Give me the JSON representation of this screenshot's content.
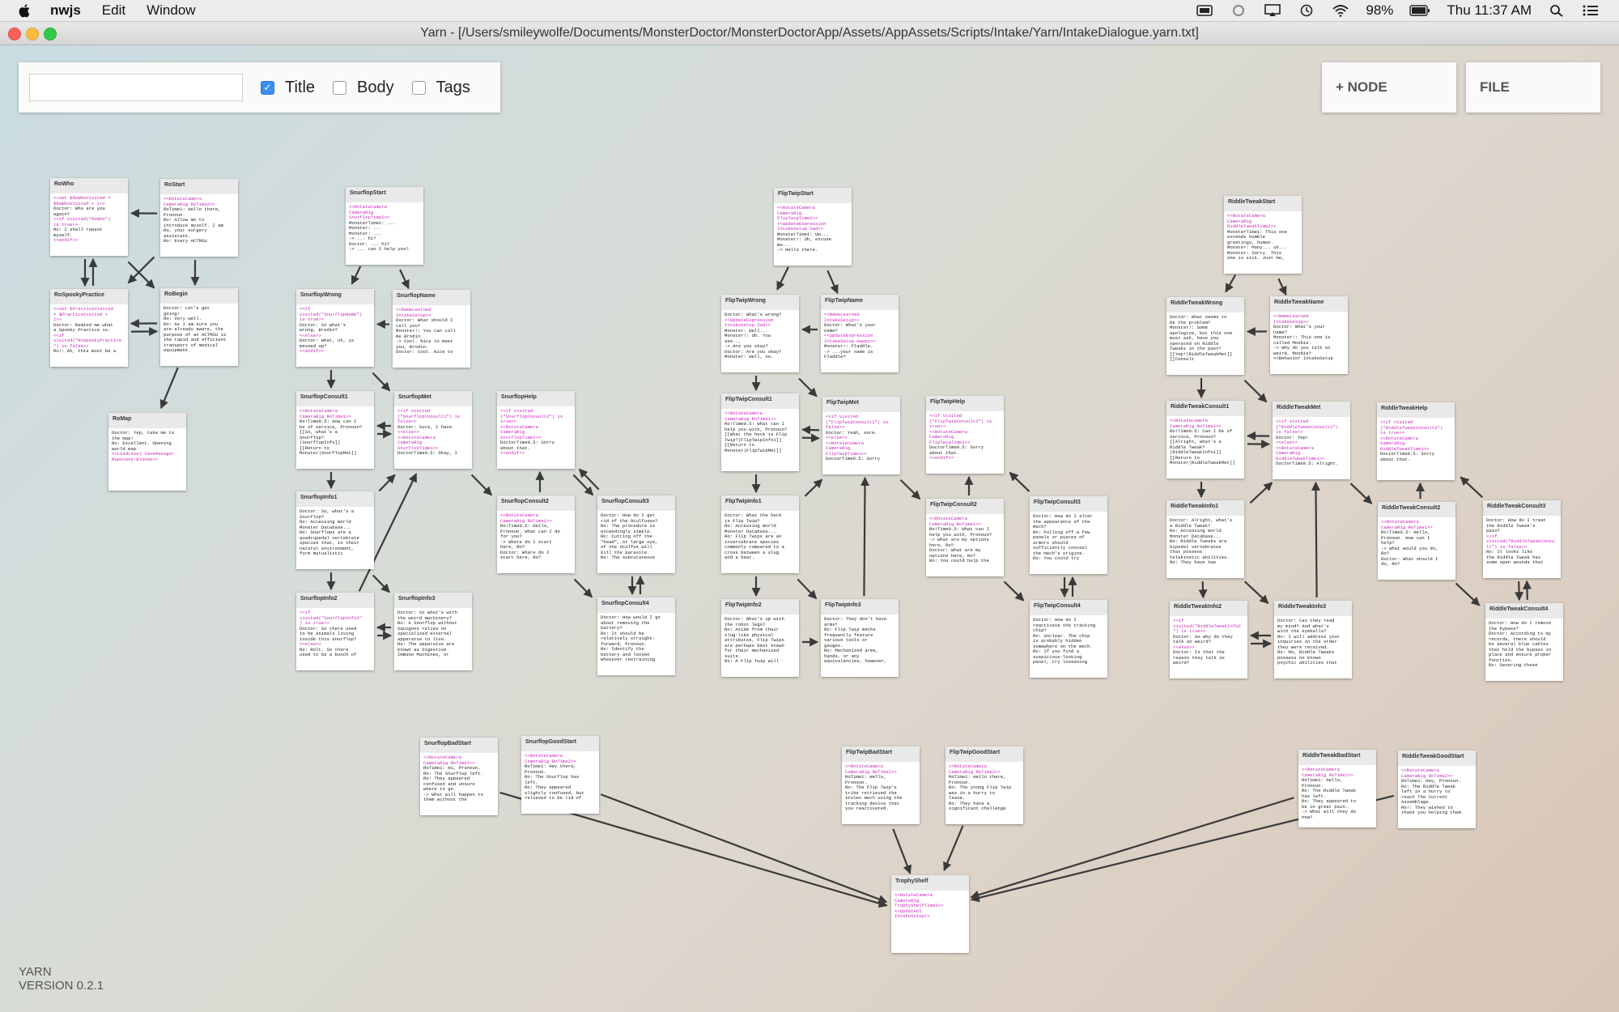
{
  "menubar": {
    "app": "nwjs",
    "items": [
      "Edit",
      "Window"
    ],
    "battery": "98%",
    "clock": "Thu 11:37 AM"
  },
  "window": {
    "title": "Yarn - [/Users/smileywolfe/Documents/MonsterDoctor/MonsterDoctorApp/Assets/AppAssets/Scripts/Intake/Yarn/IntakeDialogue.yarn.txt]"
  },
  "search": {
    "value": "",
    "title_label": "Title",
    "body_label": "Body",
    "tags_label": "Tags",
    "title_checked": true,
    "body_checked": false,
    "tags_checked": false
  },
  "buttons": {
    "node": "+ NODE",
    "file": "FILE"
  },
  "nodes": [
    {
      "title": "RoWho",
      "body": "<<set $RoWhoVisited =\n$RoWhoVisited + 1>>\nDoctor: Who are you\nagain?\n<<if visited(\"RoWho\")\nis true>>\nRo: I shall repeat\nmyself.\n<<endif>>"
    },
    {
      "title": "RoStart",
      "body": "<<RotateCamera\nCameraRig RoTime2>>\nRoTime1: Hello there,\nPronoun.\nRo: Allow me to\nintroduce myself. I am\nRo, your surgery\nassistant.\nRo: Every ACTMSU"
    },
    {
      "title": "RoSpookyPractice",
      "body": "<<set $PracticeVisited\n= $PracticeVisited +\n1>>\nDoctor: Remind me what\na Spooky Practice is.\n<<if\nvisited(\"RoSpookyPractice\n\") is false>>\nRo!: Ah, this must be a"
    },
    {
      "title": "RoBegin",
      "body": "Doctor: Let's get\ngoing!\nRo: Very well.\nRo: As I am sure you\nare already aware, the\npurpose of an ACTMSU is\nthe rapid and efficient\ntransport of medical\nequipment."
    },
    {
      "title": "RoMap",
      "body": "Doctor: Yep, take me to\nthe map!\nRo: Excellent. Opening\nworld map.\n<<LoadLevel SaveManager\nMapScene:Blonds>>"
    },
    {
      "title": "SnurflopStart",
      "body": "<<RotateCamera\nCameraRig\nSnurflopTime2>>\nMonsterTime1: ...\nMonster: ...\nMonster: ...\n-> ... hi?\nDoctor: ... hi?\n-> ... can I help you?"
    },
    {
      "title": "SnurflopWrong",
      "body": "<<if\nvisited(\"SnurflopName\")\nis true>>\nDoctor: So what's\nwrong, Brodin?\n<<else>>\nDoctor: What, uh, is\nmessed up?\n<<endif>>"
    },
    {
      "title": "SnurflopName",
      "body": "<<NameLearned\nIntakeSetup>>\nDoctor: What should I\ncall you?\nMonster!: You can call\nme Brodin.\n-> Cool. Nice to meet\nyou, Brodin.\nDoctor: Cool. Nice to"
    },
    {
      "title": "SnurflopConsult1",
      "body": "<<RotateCamera\nCameraRig RoTime1>>\nRo!Time0.5: How can I\nbe of service, Pronoun?\n[[So, what's a\nSnurflop?\n|SnurflopInfo]]\n[[Return to\nMonster|SnurflopMet]]"
    },
    {
      "title": "SnurflopMet",
      "body": "<<if visited\n(\"SnurflopConsult1\") is\nfalse>>\nDoctor: Sure, I have.\n<<else>>\n<<RotateCamera\nCameraRig\nSnurflopTime1>>\nDoctorTime0.5: Okay, I"
    },
    {
      "title": "SnurflopHelp",
      "body": "<<if visited\n(\"SnurflopConsult2\") is\ntrue>>\n<<RotateCamera\nCameraRig\nSnurflopTime1>>\nDoctorTime0.5: Sorry\nabout that.\n<<endif>>"
    },
    {
      "title": "SnurflopInfo1",
      "body": "Doctor: So, what's a\nSnurflop?\nRo: Accessing World\nMonster Database...\nRo: Snurflops are a\nquadrupedal vertebrate\nspecies that, in their\nnatural environment,\nform mutualistic"
    },
    {
      "title": "SnurflopConsult2",
      "body": "<<RotateCamera\nCameraRig RoTime1>>\nRo!Time0.5: Hello,\nPronoun. What can I do\nfor you?\n-> Where do I start\nhere, Ro?\nDoctor: Where do I\nstart here, Ro?"
    },
    {
      "title": "SnurflopConsult3",
      "body": "Doctor: How do I get\nrid of the Oculfuses?\nRo: The procedure is\nexceedingly simple.\nRo: Cutting off the\n\"head\", or large eye,\nof the Oculfus will\nkill the parasite.\nRo: The subcutaneous"
    },
    {
      "title": "SnurflopInfo2",
      "body": "<<if\nvisited(\"SnurflopInfo2\"\n) is true>>\nDoctor: So there used\nto be animals living\ninside this Snurflop?\n<<else>>\nRo: Rolt. So there\nused to be a bunch of"
    },
    {
      "title": "SnurflopInfo3",
      "body": "Doctor: So what's with\nthe weird machinery?\nRo: A Snurflop without\nSquigons relies on\nspecialized external\napparatus to live.\nRo: The apparatus are\nknown as Digestive\nImmuno Machines, or"
    },
    {
      "title": "SnurflopConsult4",
      "body": "Doctor: How would I go\nabout removing the\nbattery?\nRo: It should be\nrelatively straight-\nforward, Pronoun.\nRo: Identify the\nbattery and loosen\nwhatever restraining"
    },
    {
      "title": "FlipTwipStart",
      "body": "<<RotateCamera\nCameraRig\nFlipTwipTime2>>\n<<UpdateExpression\nIntakeSetup Sad>>\nMonsterTime1: Um...\nMonster!: Uh, excuse\nme...\n-> Hello there."
    },
    {
      "title": "FlipTwipWrong",
      "body": "Doctor: What's wrong?\n<<UpdateExpression\nIntakeSetup Sad>>\nMonster: Well...\nMonster!: Uh. You\nsee...\n-> Are you okay?\nDoctor: Are you okay?\nMonster: Well, no."
    },
    {
      "title": "FlipTwipName",
      "body": "<<NameLearned\nIntakeSetup>>\nDoctor: What's your\nname?\n<<UpdateExpression\nIntakeSetup Happy>>\nMonster!: Fladdle.\n-> ...your name is\nFladdle?"
    },
    {
      "title": "FlipTwipConsult1",
      "body": "<<RotateCamera\nCameraRig RoTime1>>\nRo!Time0.5: What can I\nhelp you with, Pronoun?\n[[What the heck is Flip\nTwip?|FlipTwipInfo1]]\n[[Return to\nMonster|FlipTwipMet]]"
    },
    {
      "title": "FlipTwipMet",
      "body": "<<if visited\n(\"FlipTwipConsult1\") is\nfalse>>\nDoctor: Yeah, sure.\n<<else>>\n<<RotateCamera\nCameraRig\nFlipTwipTime1>>\nDoctorTime0.5: Sorry"
    },
    {
      "title": "FlipTwipHelp",
      "body": "<<if visited\n(\"FlipTwipConsult2\") is\ntrue>>\n<<RotateCamera\nCameraRig\nFlipTwipTime1>>\nDoctorTime0.5: Sorry\nabout that.\n<<endif>>"
    },
    {
      "title": "FlipTwipInfo1",
      "body": "Doctor: What the heck\nis Flip Twip?\nRo: Accessing World\nMonster Database...\nRo: Flip Twips are an\ninvertebrate species\ncommonly compared to a\ncross between a slug\nand a bear."
    },
    {
      "title": "FlipTwipConsult2",
      "body": "<<RotateCamera\nCameraRig RoTime1>>\nRo!Time0.5: What can I\nhelp you with, Pronoun?\n-> What are my options\nhere, Ro?\nDoctor: What are my\noptions here, Ro?\nRo: You could help the"
    },
    {
      "title": "FlipTwipConsult3",
      "body": "Doctor: How do I alter\nthe appearance of the\nmech?\nRo: Pulling off a few\npanels or pieces of\narmors should\nsufficiently conceal\nthe mech's origins.\nRo: You could try"
    },
    {
      "title": "FlipTwipInfo2",
      "body": "Doctor: What's up with\nthe robot legs?\nRo: Aside from their\nslug-like physical\nattributes, Flip Twips\nare perhaps best known\nfor their mechanized\nsuits.\nRo: A Flip Twip will"
    },
    {
      "title": "FlipTwipInfo3",
      "body": "Doctor: They don't have\narms?\nRo: Flip Twip mechs\nfrequently feature\nvarious tools or\ngauges.\nRo: Mechanized arms,\nhands, or any\nequivalencies, however,"
    },
    {
      "title": "FlipTwipConsult4",
      "body": "Doctor: How do I\nreactivate the tracking\nchip?\nRo: Unclear. The chip\nis probably hidden\nsomewhere on the mech.\nRo: If you find a\nsuspicious-looking\npanel, try loosening"
    },
    {
      "title": "RiddleTweakStart",
      "body": "<<RotateCamera\nCameraRig\nRiddleTweakTime2>>\nMonsterTime1: This one\nextends humble\ngreetings, human.\nMonster: Many... uh...\nMonster: Sorry. This\none is sick. Just me,"
    },
    {
      "title": "RiddleTweakWrong",
      "body": "Doctor: What seems to\nbe the problem?\nMonster!: Some\napologize, but this one\nmust ask, have you\noperated on Riddle\nTweaks in the past?\n[[Yep!|RiddleTweakMet]]\n[[Consult"
    },
    {
      "title": "RiddleTweakName",
      "body": "<<NameLearned\nIntakeSetup>>\nDoctor: What's your\nname?\nMonster!: This one is\ncalled Moobie.\n-> Why do you talk so\nweird, Moobie?\n<<Behavior IntakeSetup"
    },
    {
      "title": "RiddleTweakConsult1",
      "body": "<<RotateCamera\nCameraRig RoTime1>>\nRo!Time0.5: Can I be of\nservice, Pronoun?\n[[Alright, what's a\nRiddle Tweak?\n|RiddleTweakInfo1]]\n[[Return to\nMonster|RiddleTweakMet]]"
    },
    {
      "title": "RiddleTweakMet",
      "body": "<<if visited\n(\"RiddleTweakConsult1\")\nis false>>\nDoctor: Yep!\n<<else>>\n<<RotateCamera\nCameraRig\nRiddleTweakTime1>>\nDoctorTime0.5: Alright."
    },
    {
      "title": "RiddleTweakHelp",
      "body": "<<if visited\n(\"RiddleTweakConsult2\")\nis true>>\n<<RotateCamera\nCameraRig\nRiddleTweakTime1>>\nDoctorTime0.5: Sorry\nabout that."
    },
    {
      "title": "RiddleTweakInfo1",
      "body": "Doctor: Alright, what's\na Riddle Tweak?\nRo: Accessing World\nMonster Database...\nRo: Riddle Tweaks are\nbipedal vertebrates\nthat possess\ntelekinetic abilities.\nRo: They have two"
    },
    {
      "title": "RiddleTweakConsult2",
      "body": "<<RotateCamera\nCameraRig RoTime1>>\nRo!Time0.5: Hello,\nPronoun. How can I\nhelp?\n-> What would you do,\nRo?\nDoctor: What should I\ndo, Ro?"
    },
    {
      "title": "RiddleTweakConsult3",
      "body": "Doctor: How do I treat\nthe Riddle Tweak's\npain?\n<<if\nvisited(\"RiddleTweakConsu\nlt\") is false>>\nRo: It looks like\nthe Riddle Tweak has\nsome open wounds that"
    },
    {
      "title": "RiddleTweakInfo2",
      "body": "<<if\nvisited(\"RiddleTweakInfo2\n\") is true>>\nDoctor: So why do they\ntalk so weird?\n<<else>>\nDoctor: Is that the\nreason they talk so\nweird?"
    },
    {
      "title": "RiddleTweakInfo3",
      "body": "Doctor: Can they read\nmy mind? And what's\nwith the eyeballs?\nRo: I will address your\ninquiries in the order\nthey were received.\nRo: No, Riddle Tweaks\npossess no known\npsychic abilities that"
    },
    {
      "title": "RiddleTweakConsult4",
      "body": "Doctor: How do I remove\nthe bypass?\nDoctor: According to my\nrecords, there should\nbe several blue cables\nthat hold the bypass in\nplace and ensure proper\nfunction.\nRo: Severing these"
    },
    {
      "title": "SnurflopBadStart",
      "body": "<<RotateCamera\nCameraRig RoTime2>>\nRoTime1: Hi, Pronoun.\nRo: The Snurflop left.\nRo: They appeared\nconfused and unsure\nwhere to go.\n-> What will happen to\nthem without the"
    },
    {
      "title": "SnurflopGoodStart",
      "body": "<<RotateCamera\nCameraRig RoTime2>>\nRoTime1: Hey there,\nPronoun.\nRo: The Snurflop has\nleft.\nRo: They appeared\nslightly confused, but\nrelieved to be rid of"
    },
    {
      "title": "FlipTwipBadStart",
      "body": "<<RotateCamera\nCameraRig RoTime2>>\nRoTime1: Hello,\nPronoun.\nRo: The Flip Twip's\ntribe retrieved the\nstolen mech using the\ntracking device that\nyou reactivated."
    },
    {
      "title": "FlipTwipGoodStart",
      "body": "<<RotateCamera\nCameraRig RoTime2>>\nRoTime1: Hello there,\nPronoun.\nRo: The young Flip Twip\nwas in a hurry to\nleave.\nRo: They have a\nsignificant challenge"
    },
    {
      "title": "RiddleTweakBadStart",
      "body": "<<RotateCamera\nCameraRig RoTime2>>\nRoTime1: Hello,\nPronoun.\nRo: The Riddle Tweak\nhas left.\nRo: They appeared to\nbe in great pain.\n-> What will they do\nnow?"
    },
    {
      "title": "RiddleTweakGoodStart",
      "body": "<<RotateCamera\nCameraRig RoTime2>>\nRoTime1: Hey, Pronoun.\nRo: The Riddle Tweak\nleft in a hurry to\nreach The Current\nAssemblage.\nRo!: They wished to\nthank you helping them"
    },
    {
      "title": "TrophyShelf",
      "body": "<<RotateCamera\nCameraRig\nTrophyShelfTime2>>\n<<UpdateUI\nIntakeSetup>>"
    }
  ],
  "footer": {
    "name": "YARN",
    "version": "VERSION 0.2.1"
  }
}
